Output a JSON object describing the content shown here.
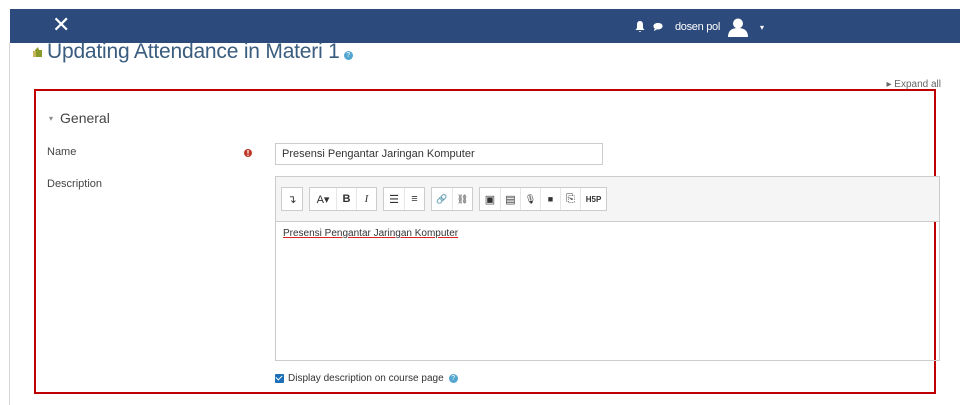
{
  "navbar": {
    "close_label": "✕",
    "username": "dosen pol",
    "caret": "▾",
    "icons": [
      "bell-icon",
      "chat-icon",
      "avatar-icon"
    ]
  },
  "page": {
    "title": "Updating Attendance in Materi 1",
    "help_glyph": "?"
  },
  "expand_all": "Expand all",
  "section": {
    "legend": "General",
    "legend_glyph": "▾"
  },
  "form": {
    "name_label": "Name",
    "name_value": "Presensi Pengantar Jaringan Komputer",
    "description_label": "Description",
    "description_content": "Presensi Pengantar Jaringan Komputer",
    "display_description_label": "Display description on course page",
    "display_description_checked": true
  },
  "toolbar": {
    "groups": [
      [
        {
          "icon": "collapse-toolbar-icon",
          "glyph": "↴"
        }
      ],
      [
        {
          "icon": "text-style-icon",
          "glyph": "A▾"
        },
        {
          "icon": "bold-icon",
          "glyph": "B"
        },
        {
          "icon": "italic-icon",
          "glyph": "I"
        }
      ],
      [
        {
          "icon": "unordered-list-icon",
          "glyph": "☰"
        },
        {
          "icon": "ordered-list-icon",
          "glyph": "≡"
        }
      ],
      [
        {
          "icon": "link-icon",
          "glyph": "🔗"
        },
        {
          "icon": "unlink-icon",
          "glyph": "⛓"
        }
      ],
      [
        {
          "icon": "image-icon",
          "glyph": "▣"
        },
        {
          "icon": "media-icon",
          "glyph": "▤"
        },
        {
          "icon": "record-audio-icon",
          "glyph": "🎙"
        },
        {
          "icon": "record-video-icon",
          "glyph": "■"
        },
        {
          "icon": "manage-files-icon",
          "glyph": "⎘"
        },
        {
          "icon": "h5p-icon",
          "glyph": "H5P"
        }
      ]
    ]
  },
  "colors": {
    "navbar": "#2c4a7b",
    "title": "#3a5c7e",
    "highlight_border": "#c00000",
    "required": "#c0392b",
    "checkbox": "#1b6fb6"
  }
}
